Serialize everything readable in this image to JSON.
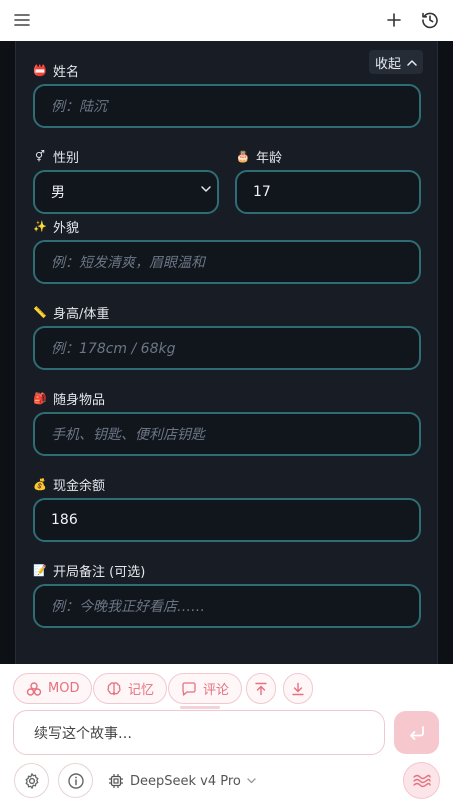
{
  "header": {
    "menu_icon": "hamburger-menu-icon",
    "add_icon": "plus-icon",
    "history_icon": "history-clock-icon"
  },
  "panel": {
    "collapse_label": "收起",
    "fields": {
      "name": {
        "emoji": "📛",
        "label": "姓名",
        "placeholder": "例：陆沉",
        "value": ""
      },
      "gender": {
        "emoji": "⚥",
        "label": "性别",
        "value": "男"
      },
      "age": {
        "emoji": "🎂",
        "label": "年龄",
        "value": "17"
      },
      "appearance": {
        "emoji": "✨",
        "label": "外貌",
        "placeholder": "例：短发清爽，眉眼温和",
        "value": ""
      },
      "height_weight": {
        "emoji": "📏",
        "label": "身高/体重",
        "placeholder": "例：178cm / 68kg",
        "value": ""
      },
      "belongings": {
        "emoji": "🎒",
        "label": "随身物品",
        "placeholder": "手机、钥匙、便利店钥匙",
        "value": ""
      },
      "cash": {
        "emoji": "💰",
        "label": "现金余额",
        "value": "186"
      },
      "notes": {
        "emoji": "📝",
        "label": "开局备注 (可选)",
        "placeholder": "例：今晚我正好看店……",
        "value": ""
      }
    }
  },
  "toolbar": {
    "mod_label": "MOD",
    "memory_label": "记忆",
    "comment_label": "评论"
  },
  "composer": {
    "placeholder": "续写这个故事…",
    "model_label": "DeepSeek v4 Pro"
  },
  "colors": {
    "accent": "#e6717f",
    "field_border": "#2f6d74",
    "panel_bg": "#171c25"
  }
}
